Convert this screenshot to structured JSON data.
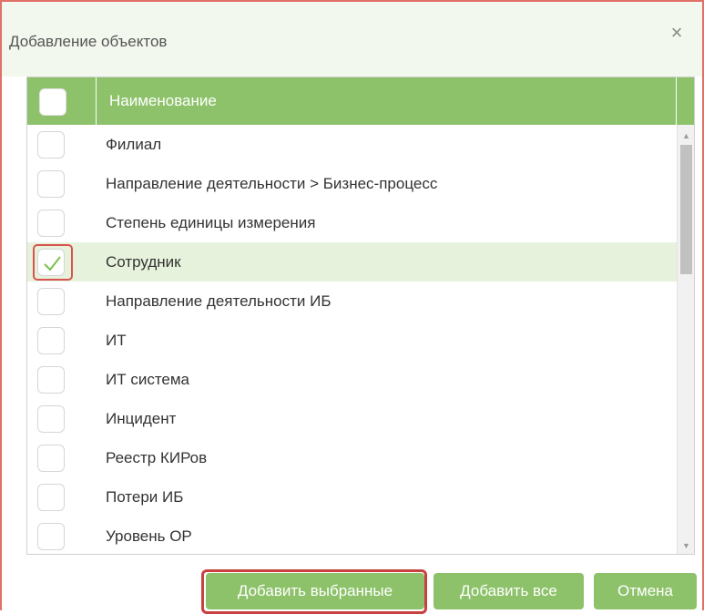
{
  "dialog": {
    "title": "Добавление объектов",
    "close_glyph": "×"
  },
  "grid": {
    "header_label": "Наименование",
    "rows": [
      {
        "label": "Филиал",
        "checked": false
      },
      {
        "label": "Направление деятельности > Бизнес-процесс",
        "checked": false
      },
      {
        "label": "Степень единицы измерения",
        "checked": false
      },
      {
        "label": "Сотрудник",
        "checked": true
      },
      {
        "label": "Направление деятельности ИБ",
        "checked": false
      },
      {
        "label": "ИТ",
        "checked": false
      },
      {
        "label": "ИТ система",
        "checked": false
      },
      {
        "label": "Инцидент",
        "checked": false
      },
      {
        "label": "Реестр КИРов",
        "checked": false
      },
      {
        "label": "Потери ИБ",
        "checked": false
      },
      {
        "label": "Уровень ОР",
        "checked": false
      }
    ],
    "scroll_up_glyph": "▲",
    "scroll_down_glyph": "▼"
  },
  "footer": {
    "add_selected_label": "Добавить выбранные",
    "add_all_label": "Добавить все",
    "cancel_label": "Отмена"
  },
  "colors": {
    "accent": "#8dc26a",
    "header_bg": "#f3f8ee",
    "selected_row": "#e6f2dc",
    "highlight": "#d9534f",
    "checkmark": "#7bbf4e"
  },
  "icons": {
    "close": "close-icon",
    "check": "checkmark-icon",
    "scroll_up": "chevron-up-icon",
    "scroll_down": "chevron-down-icon"
  }
}
